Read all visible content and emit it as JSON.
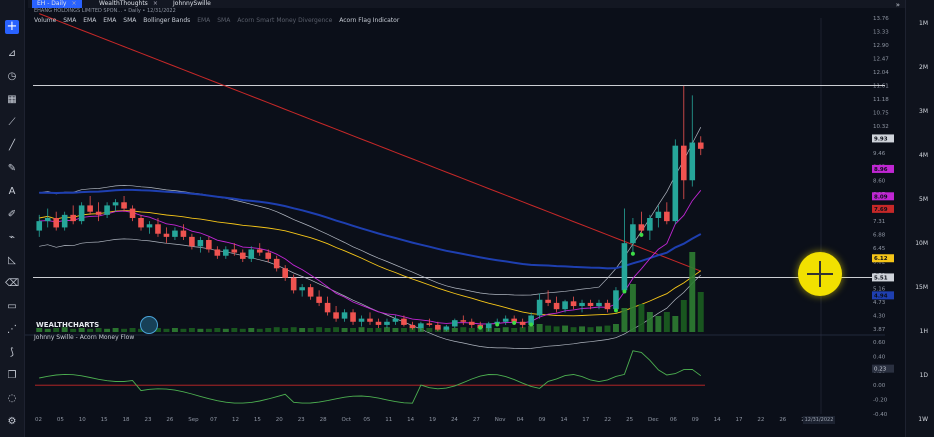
{
  "tabs": [
    {
      "label": "EH - Daily",
      "active": true
    },
    {
      "label": "WealthThoughts",
      "active": false
    },
    {
      "label": "JohnnySwille",
      "active": false
    }
  ],
  "legend": {
    "symbol_line": "EHANG HOLDINGS LIMITED SPON... • Daily • 12/31/2022",
    "indicators": [
      "Volume",
      "SMA",
      "EMA",
      "EMA",
      "SMA",
      "Bollinger Bands",
      "EMA",
      "SMA",
      "Acorn Smart Money Divergence",
      "Acorn Flag Indicator"
    ],
    "sub_indicator": "Johnny Swille - Acorn Money Flow"
  },
  "brand": {
    "name": "WEALTHCHARTS"
  },
  "right_panel": [
    "1M",
    "2M",
    "3M",
    "4M",
    "5M",
    "10M",
    "15M",
    "1H",
    "1D",
    "1W"
  ],
  "cursor_date": "12/31/2022",
  "colors": {
    "up": "#26a69a",
    "down": "#ef5350",
    "sma200": "#c62828",
    "ema_blue": "#1e3fb0",
    "sma_yellow": "#f5c518",
    "ema_purple": "#c026d3",
    "bb": "#b0b6c0",
    "mf": "#4caf50"
  },
  "chart_data": {
    "type": "candlestick",
    "price_axis": {
      "ticks": [
        13.76,
        13.33,
        12.9,
        12.47,
        12.04,
        11.61,
        11.18,
        10.75,
        10.32,
        9.89,
        9.46,
        9.03,
        8.6,
        8.17,
        7.74,
        7.31,
        6.88,
        6.45,
        6.02,
        5.59,
        5.16,
        4.73,
        4.3,
        3.87
      ]
    },
    "price_labels": [
      {
        "value": 9.93,
        "label": "9.93",
        "color": "#cfd3da"
      },
      {
        "value": 8.96,
        "label": "8.96",
        "color": "#c026d3"
      },
      {
        "value": 8.09,
        "label": "8.09",
        "color": "#c026d3"
      },
      {
        "value": 7.69,
        "label": "7.69",
        "color": "#c62828"
      },
      {
        "value": 6.12,
        "label": "6.12",
        "color": "#f5c518"
      },
      {
        "value": 5.51,
        "label": "5.51",
        "color": "#cfd3da"
      },
      {
        "value": 4.94,
        "label": "4.94",
        "color": "#1e3fb0"
      }
    ],
    "horizontal_lines": [
      11.61,
      5.51
    ],
    "x_ticks": [
      "02",
      "05",
      "10",
      "15",
      "18",
      "23",
      "26",
      "Sep",
      "07",
      "12",
      "15",
      "20",
      "23",
      "28",
      "Oct",
      "05",
      "11",
      "14",
      "19",
      "24",
      "27",
      "Nov",
      "04",
      "09",
      "14",
      "17",
      "22",
      "25",
      "Dec",
      "06",
      "09",
      "14",
      "17",
      "22",
      "26",
      "29",
      "04"
    ],
    "candles": [
      [
        7.0,
        7.5,
        6.8,
        7.3
      ],
      [
        7.3,
        7.7,
        7.1,
        7.4
      ],
      [
        7.4,
        7.6,
        7.0,
        7.1
      ],
      [
        7.1,
        7.6,
        7.0,
        7.5
      ],
      [
        7.5,
        7.8,
        7.2,
        7.3
      ],
      [
        7.3,
        7.9,
        7.2,
        7.8
      ],
      [
        7.8,
        8.1,
        7.5,
        7.6
      ],
      [
        7.6,
        7.9,
        7.3,
        7.5
      ],
      [
        7.5,
        7.9,
        7.4,
        7.8
      ],
      [
        7.8,
        8.0,
        7.6,
        7.9
      ],
      [
        7.9,
        8.1,
        7.6,
        7.7
      ],
      [
        7.7,
        7.8,
        7.3,
        7.4
      ],
      [
        7.4,
        7.5,
        7.0,
        7.1
      ],
      [
        7.1,
        7.3,
        6.9,
        7.2
      ],
      [
        7.2,
        7.4,
        6.8,
        6.9
      ],
      [
        6.9,
        7.1,
        6.6,
        6.8
      ],
      [
        6.8,
        7.1,
        6.7,
        7.0
      ],
      [
        7.0,
        7.2,
        6.7,
        6.8
      ],
      [
        6.8,
        6.9,
        6.4,
        6.5
      ],
      [
        6.5,
        6.8,
        6.3,
        6.7
      ],
      [
        6.7,
        6.8,
        6.3,
        6.4
      ],
      [
        6.4,
        6.5,
        6.1,
        6.2
      ],
      [
        6.2,
        6.5,
        6.1,
        6.4
      ],
      [
        6.4,
        6.6,
        6.2,
        6.3
      ],
      [
        6.3,
        6.4,
        6.0,
        6.1
      ],
      [
        6.1,
        6.5,
        6.0,
        6.4
      ],
      [
        6.4,
        6.6,
        6.2,
        6.3
      ],
      [
        6.3,
        6.4,
        6.0,
        6.1
      ],
      [
        6.1,
        6.2,
        5.7,
        5.8
      ],
      [
        5.8,
        5.9,
        5.4,
        5.5
      ],
      [
        5.5,
        5.6,
        5.0,
        5.1
      ],
      [
        5.1,
        5.3,
        4.9,
        5.2
      ],
      [
        5.2,
        5.3,
        4.8,
        4.9
      ],
      [
        4.9,
        5.1,
        4.6,
        4.7
      ],
      [
        4.7,
        4.9,
        4.3,
        4.4
      ],
      [
        4.4,
        4.6,
        4.1,
        4.2
      ],
      [
        4.2,
        4.5,
        4.1,
        4.4
      ],
      [
        4.4,
        4.5,
        4.0,
        4.1
      ],
      [
        4.1,
        4.3,
        3.95,
        4.2
      ],
      [
        4.2,
        4.4,
        4.0,
        4.1
      ],
      [
        4.1,
        4.2,
        3.9,
        4.0
      ],
      [
        4.0,
        4.2,
        3.9,
        4.1
      ],
      [
        4.1,
        4.3,
        4.0,
        4.2
      ],
      [
        4.2,
        4.3,
        3.95,
        4.0
      ],
      [
        4.0,
        4.1,
        3.85,
        3.9
      ],
      [
        3.9,
        4.1,
        3.8,
        4.05
      ],
      [
        4.05,
        4.2,
        3.95,
        4.0
      ],
      [
        4.0,
        4.1,
        3.8,
        3.85
      ],
      [
        3.85,
        4.0,
        3.8,
        3.95
      ],
      [
        3.95,
        4.2,
        3.9,
        4.15
      ],
      [
        4.15,
        4.3,
        4.0,
        4.1
      ],
      [
        4.1,
        4.2,
        3.9,
        4.0
      ],
      [
        4.0,
        4.1,
        3.85,
        3.9
      ],
      [
        3.9,
        4.1,
        3.8,
        4.05
      ],
      [
        4.05,
        4.2,
        3.95,
        4.1
      ],
      [
        4.1,
        4.3,
        4.0,
        4.2
      ],
      [
        4.2,
        4.3,
        4.0,
        4.1
      ],
      [
        4.1,
        4.2,
        3.9,
        4.0
      ],
      [
        4.0,
        4.4,
        3.95,
        4.3
      ],
      [
        4.3,
        5.0,
        4.2,
        4.8
      ],
      [
        4.8,
        5.1,
        4.6,
        4.7
      ],
      [
        4.7,
        4.9,
        4.4,
        4.5
      ],
      [
        4.5,
        4.8,
        4.4,
        4.75
      ],
      [
        4.75,
        4.9,
        4.5,
        4.6
      ],
      [
        4.6,
        4.8,
        4.4,
        4.7
      ],
      [
        4.7,
        4.8,
        4.5,
        4.6
      ],
      [
        4.6,
        4.8,
        4.5,
        4.7
      ],
      [
        4.7,
        4.8,
        4.4,
        4.5
      ],
      [
        4.5,
        5.2,
        4.4,
        5.1
      ],
      [
        5.1,
        7.7,
        5.0,
        6.6
      ],
      [
        6.6,
        7.4,
        6.2,
        7.2
      ],
      [
        7.2,
        7.6,
        6.8,
        7.0
      ],
      [
        7.0,
        7.5,
        6.7,
        7.4
      ],
      [
        7.4,
        7.8,
        7.1,
        7.6
      ],
      [
        7.6,
        7.9,
        7.2,
        7.3
      ],
      [
        7.3,
        9.9,
        7.2,
        9.7
      ],
      [
        9.7,
        11.6,
        8.0,
        8.6
      ],
      [
        8.6,
        11.3,
        8.4,
        9.8
      ],
      [
        9.8,
        10.0,
        9.4,
        9.6
      ]
    ],
    "volume": [
      0.05,
      0.04,
      0.05,
      0.06,
      0.04,
      0.05,
      0.04,
      0.05,
      0.04,
      0.05,
      0.04,
      0.05,
      0.04,
      0.04,
      0.05,
      0.04,
      0.05,
      0.04,
      0.05,
      0.04,
      0.04,
      0.05,
      0.04,
      0.05,
      0.04,
      0.05,
      0.04,
      0.05,
      0.06,
      0.05,
      0.06,
      0.05,
      0.05,
      0.06,
      0.05,
      0.06,
      0.05,
      0.05,
      0.06,
      0.05,
      0.05,
      0.06,
      0.05,
      0.05,
      0.06,
      0.05,
      0.05,
      0.06,
      0.05,
      0.05,
      0.06,
      0.05,
      0.05,
      0.06,
      0.05,
      0.06,
      0.05,
      0.06,
      0.08,
      0.1,
      0.08,
      0.07,
      0.08,
      0.06,
      0.07,
      0.06,
      0.07,
      0.08,
      0.1,
      0.3,
      0.6,
      0.35,
      0.25,
      0.2,
      0.25,
      0.2,
      0.4,
      1.0,
      0.5
    ],
    "money_flow": {
      "axis": [
        0.6,
        0.4,
        0.2,
        0.0,
        -0.2,
        -0.4
      ],
      "current": "0.23"
    }
  }
}
